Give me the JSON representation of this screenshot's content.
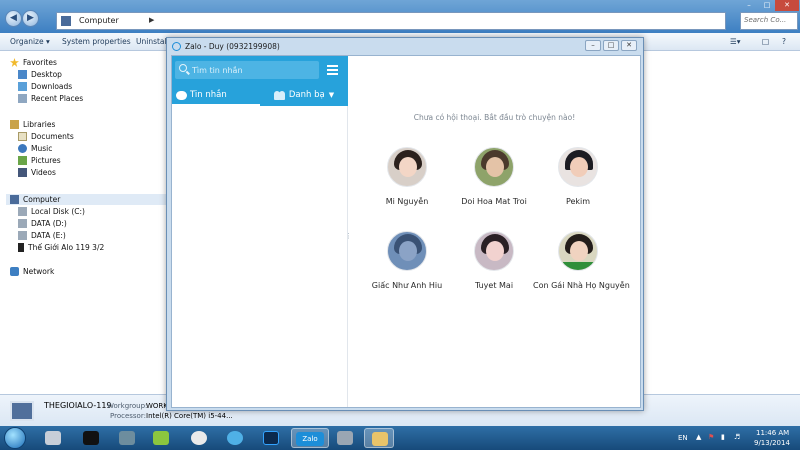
{
  "explorer": {
    "address": "Computer",
    "search_placeholder": "Search Co...",
    "toolbar": {
      "organize": "Organize ▾",
      "system_properties": "System properties",
      "uninstall": "Uninstall"
    },
    "nav": {
      "favorites": "Favorites",
      "favorites_items": [
        "Desktop",
        "Downloads",
        "Recent Places"
      ],
      "libraries": "Libraries",
      "libraries_items": [
        "Documents",
        "Music",
        "Pictures",
        "Videos"
      ],
      "computer": "Computer",
      "computer_items": [
        "Local Disk (C:)",
        "DATA (D:)",
        "DATA (E:)",
        "Thế Giới Alo 119 3/2"
      ],
      "network": "Network"
    },
    "details": {
      "name": "THEGIOIALO-119",
      "workgroup_label": "Workgroup:",
      "workgroup_value": "WORK",
      "processor_label": "Processor:",
      "processor_value": "Intel(R) Core(TM) i5-44..."
    }
  },
  "zalo": {
    "title": "Zalo - Duy (0932199908)",
    "controls": {
      "minimize": "–",
      "restore": "□",
      "close": "✕"
    },
    "search_placeholder": "Tìm tin nhắn",
    "tabs": {
      "messages": "Tin nhắn",
      "contacts": "Danh bạ"
    },
    "empty_text": "Chưa có hội thoại. Bắt đầu trò chuyện nào!",
    "contacts": [
      {
        "name": "Mi Nguyễn"
      },
      {
        "name": "Doi Hoa Mat Troi"
      },
      {
        "name": "Pekim"
      },
      {
        "name": "Giấc Như Anh Hiu"
      },
      {
        "name": "Tuyet Mai"
      },
      {
        "name": "Con Gái Nhà Họ Nguyễn"
      }
    ]
  },
  "taskbar": {
    "language": "EN",
    "time": "11:46 AM",
    "date": "9/13/2014",
    "active_app": "Zalo"
  },
  "colors": {
    "zalo_blue": "#27a2db",
    "taskbar": "#174a7a",
    "explorer_title": "#3d7fc2"
  }
}
